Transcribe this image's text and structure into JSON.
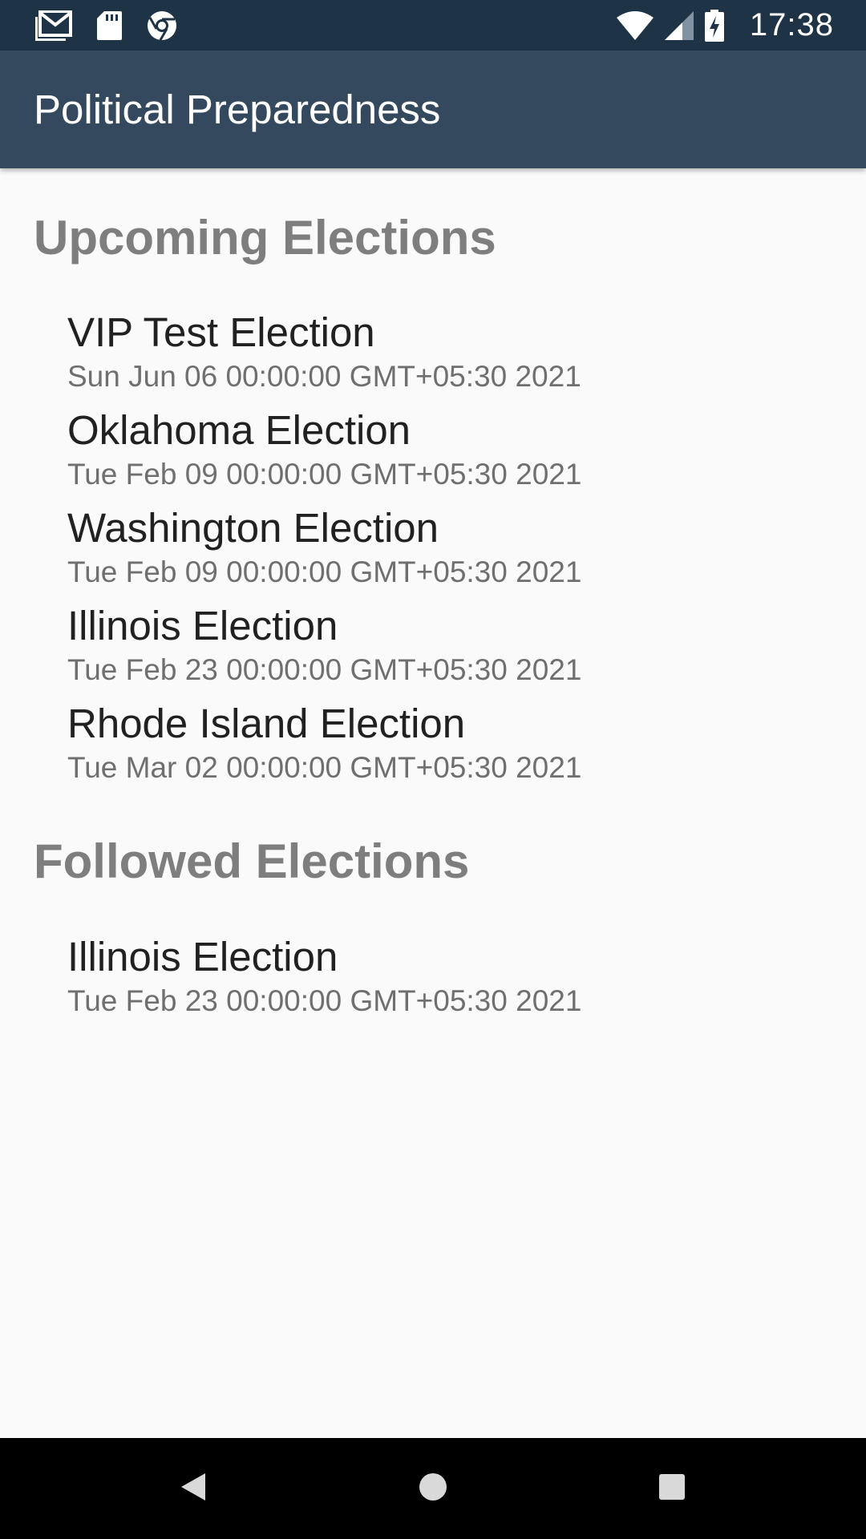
{
  "status_bar": {
    "time": "17:38",
    "left_icons": [
      "gmail-icon",
      "sd-card-icon",
      "chrome-icon"
    ],
    "right_icons": [
      "wifi-icon",
      "signal-icon",
      "battery-charging-icon"
    ]
  },
  "app_bar": {
    "title": "Political Preparedness",
    "background": "#34495e"
  },
  "upcoming": {
    "title": "Upcoming Elections",
    "items": [
      {
        "name": "VIP Test Election",
        "date": "Sun Jun 06 00:00:00 GMT+05:30 2021"
      },
      {
        "name": "Oklahoma Election",
        "date": "Tue Feb 09 00:00:00 GMT+05:30 2021"
      },
      {
        "name": "Washington Election",
        "date": "Tue Feb 09 00:00:00 GMT+05:30 2021"
      },
      {
        "name": "Illinois Election",
        "date": "Tue Feb 23 00:00:00 GMT+05:30 2021"
      },
      {
        "name": "Rhode Island Election",
        "date": "Tue Mar 02 00:00:00 GMT+05:30 2021"
      }
    ]
  },
  "followed": {
    "title": "Followed Elections",
    "items": [
      {
        "name": "Illinois Election",
        "date": "Tue Feb 23 00:00:00 GMT+05:30 2021"
      }
    ]
  },
  "nav_bar": {
    "buttons": [
      "back-icon",
      "home-icon",
      "recents-icon"
    ]
  },
  "colors": {
    "status_bar": "#1e3346",
    "section_title": "#7e7e7e",
    "item_title": "#212121",
    "item_date": "#6f6f6f"
  }
}
